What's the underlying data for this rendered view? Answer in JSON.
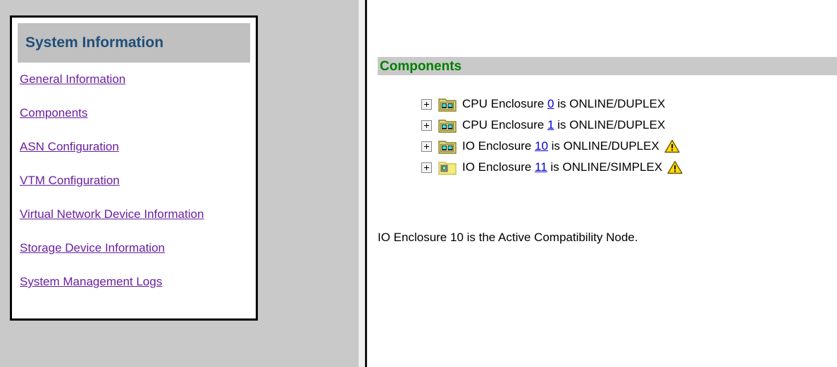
{
  "colors": {
    "panel_gray": "#c9c9c9",
    "header_band_gray": "#c0c0c0",
    "sidebar_title_blue": "#1f4e79",
    "sidebar_link_purple": "#6a1fa0",
    "components_green": "#008000",
    "tree_link_blue": "#0000cc",
    "warning_yellow": "#ffd800",
    "folder_yellow": "#a9a032"
  },
  "sidebar": {
    "title": "System Information",
    "items": [
      {
        "label": "General Information",
        "name": "sidebar-link-general-information"
      },
      {
        "label": "Components",
        "name": "sidebar-link-components"
      },
      {
        "label": "ASN Configuration",
        "name": "sidebar-link-asn-configuration"
      },
      {
        "label": "VTM Configuration",
        "name": "sidebar-link-vtm-configuration"
      },
      {
        "label": "Virtual Network Device Information",
        "name": "sidebar-link-virtual-network-device-information"
      },
      {
        "label": "Storage Device Information",
        "name": "sidebar-link-storage-device-information"
      },
      {
        "label": "System Management Logs",
        "name": "sidebar-link-system-management-logs"
      }
    ]
  },
  "content": {
    "heading": "Components",
    "tree": [
      {
        "expander": "plus",
        "icon": "cpu-enclosure-icon",
        "icon_variant": "duplex",
        "prefix": "CPU Enclosure ",
        "link": "0",
        "suffix": " is ONLINE/DUPLEX",
        "warning": false
      },
      {
        "expander": "plus",
        "icon": "cpu-enclosure-icon",
        "icon_variant": "duplex",
        "prefix": "CPU Enclosure ",
        "link": "1",
        "suffix": " is ONLINE/DUPLEX",
        "warning": false
      },
      {
        "expander": "plus",
        "icon": "io-enclosure-icon",
        "icon_variant": "duplex",
        "prefix": "IO Enclosure ",
        "link": "10",
        "suffix": " is ONLINE/DUPLEX",
        "warning": true
      },
      {
        "expander": "plus",
        "icon": "io-enclosure-icon",
        "icon_variant": "simplex",
        "prefix": "IO Enclosure ",
        "link": "11",
        "suffix": " is ONLINE/SIMPLEX",
        "warning": true
      }
    ],
    "footer_note": "IO Enclosure 10 is the Active Compatibility Node."
  }
}
